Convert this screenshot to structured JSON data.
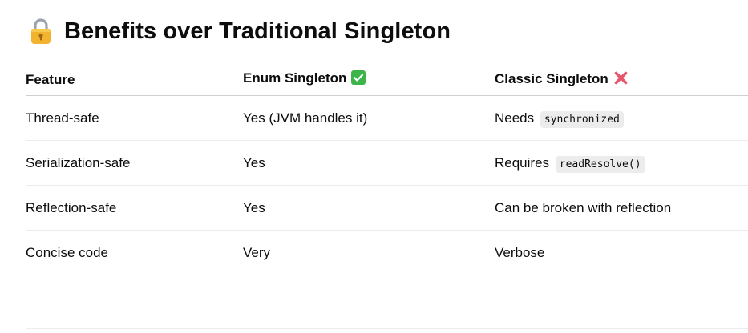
{
  "heading": {
    "icon": "lock-icon",
    "title": "Benefits over Traditional Singleton"
  },
  "table": {
    "headers": {
      "feature": "Feature",
      "enum": "Enum Singleton",
      "enum_icon": "check-mark-icon",
      "classic": "Classic Singleton",
      "classic_icon": "cross-mark-icon"
    },
    "rows": [
      {
        "feature": "Thread-safe",
        "enum": "Yes (JVM handles it)",
        "classic_text": "Needs",
        "classic_code": "synchronized"
      },
      {
        "feature": "Serialization-safe",
        "enum": "Yes",
        "classic_text": "Requires",
        "classic_code": "readResolve()"
      },
      {
        "feature": "Reflection-safe",
        "enum": "Yes",
        "classic_text": "Can be broken with reflection",
        "classic_code": ""
      },
      {
        "feature": "Concise code",
        "enum": "Very",
        "classic_text": "Verbose",
        "classic_code": ""
      }
    ]
  },
  "colors": {
    "check_green": "#3bb54a",
    "cross_red": "#e8556b",
    "lock_gold": "#f2b32e",
    "code_bg": "#ececec"
  }
}
